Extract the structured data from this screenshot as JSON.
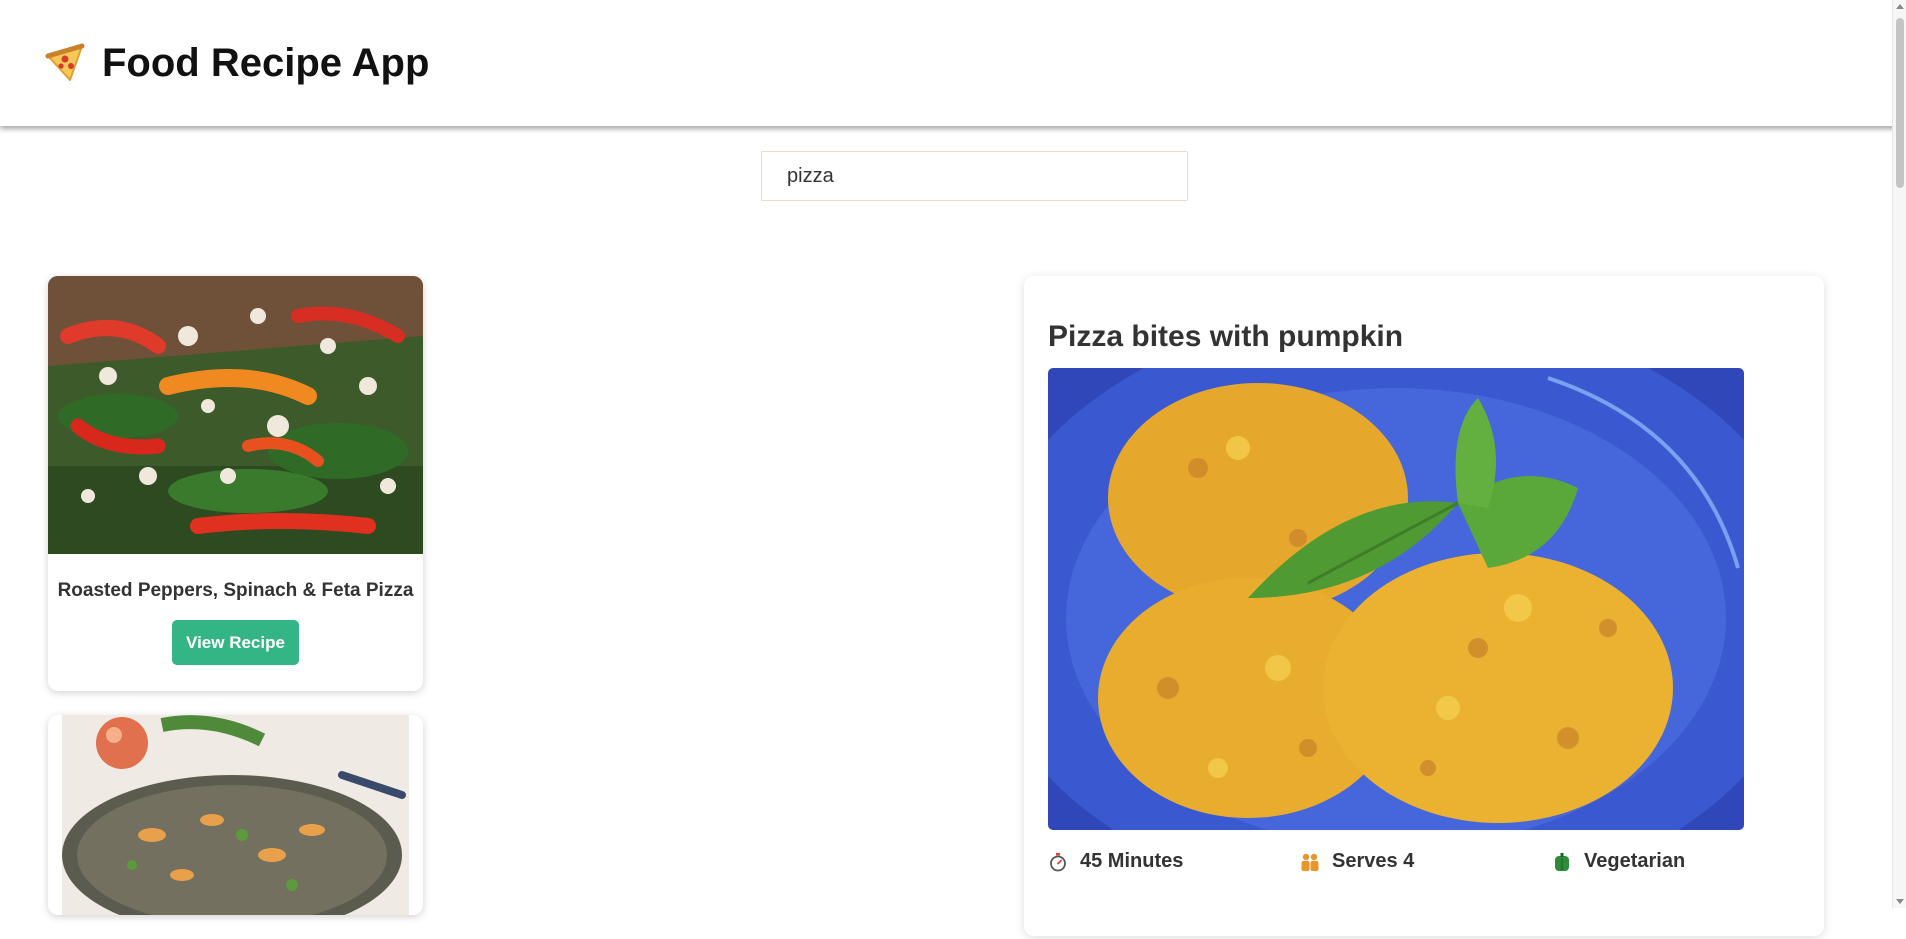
{
  "header": {
    "title": "Food Recipe App",
    "logo_icon": "pizza-slice-icon"
  },
  "search": {
    "value": "pizza",
    "placeholder": ""
  },
  "results": [
    {
      "title": "Roasted Peppers, Spinach & Feta Pizza",
      "button_label": "View Recipe",
      "image_icon": "pizza-photo"
    },
    {
      "title": "",
      "button_label": "",
      "image_icon": "peach-pizza-photo"
    }
  ],
  "detail": {
    "title": "Pizza bites with pumpkin",
    "image_icon": "pumpkin-pizza-bites-photo",
    "time": "45 Minutes",
    "servings": "Serves 4",
    "diet": "Vegetarian",
    "time_icon": "stopwatch-icon",
    "servings_icon": "people-icon",
    "diet_icon": "green-pepper-icon"
  },
  "colors": {
    "accent": "#34b585",
    "header_shadow": "#999999"
  }
}
